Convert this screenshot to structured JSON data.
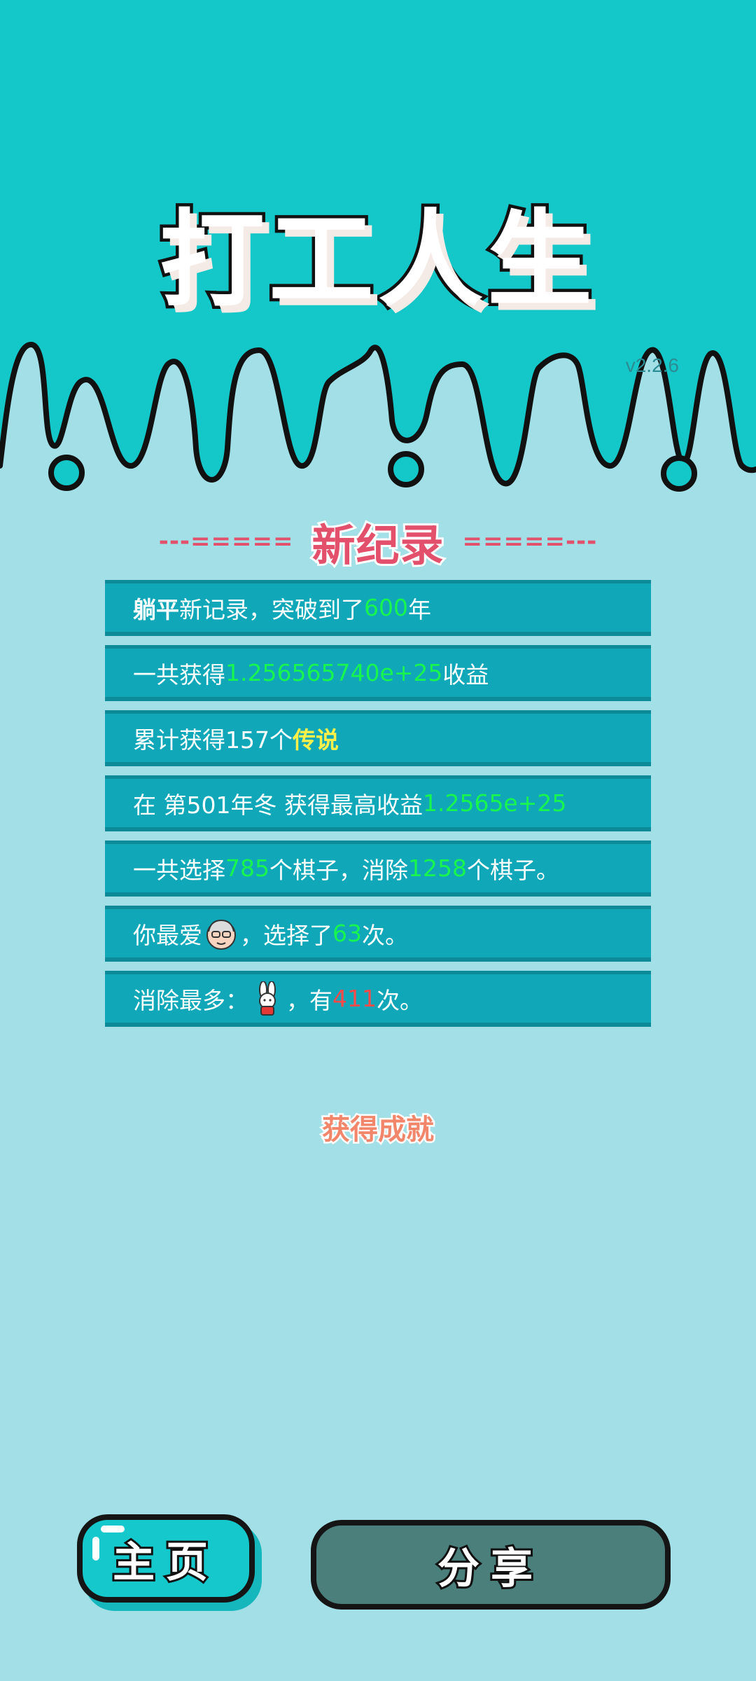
{
  "game": {
    "title": "打工人生",
    "version": "v2.2.6"
  },
  "record_header": {
    "deco_left": "---=====",
    "label": "新纪录",
    "deco_right": "=====---"
  },
  "stats": [
    {
      "segments": [
        {
          "text": "躺平",
          "style": "bold"
        },
        {
          "text": "新记录，突破到了"
        },
        {
          "text": "600",
          "style": "green"
        },
        {
          "text": "年"
        }
      ]
    },
    {
      "segments": [
        {
          "text": "一共获得"
        },
        {
          "text": "1.256565740e+25",
          "style": "green"
        },
        {
          "text": "收益"
        }
      ]
    },
    {
      "segments": [
        {
          "text": "累计获得157个"
        },
        {
          "text": "传说",
          "style": "yellow"
        }
      ]
    },
    {
      "segments": [
        {
          "text": "在 第501年冬 获得最高收益"
        },
        {
          "text": "1.2565e+25",
          "style": "green"
        }
      ]
    },
    {
      "segments": [
        {
          "text": "一共选择"
        },
        {
          "text": "785",
          "style": "green"
        },
        {
          "text": "个棋子，消除"
        },
        {
          "text": "1258",
          "style": "green"
        },
        {
          "text": "个棋子。"
        }
      ]
    },
    {
      "segments": [
        {
          "text": "你最爱"
        },
        {
          "icon": "old-man-face-icon"
        },
        {
          "text": "，选择了"
        },
        {
          "text": "63",
          "style": "green"
        },
        {
          "text": "次。"
        }
      ]
    },
    {
      "segments": [
        {
          "text": "消除最多："
        },
        {
          "icon": "rabbit-icon"
        },
        {
          "text": "，有"
        },
        {
          "text": "411",
          "style": "red"
        },
        {
          "text": "次。"
        }
      ]
    }
  ],
  "achievement_link": "获得成就",
  "buttons": {
    "home": "主页",
    "share": "分享"
  },
  "colors": {
    "top_band": "#14c8c9",
    "page_bg": "#a2dfe6",
    "row_bg": "#10a8b8",
    "highlight_green": "#19f54f",
    "highlight_yellow": "#fff04a",
    "highlight_red": "#ff4a4a",
    "header_red": "#e2506b"
  }
}
